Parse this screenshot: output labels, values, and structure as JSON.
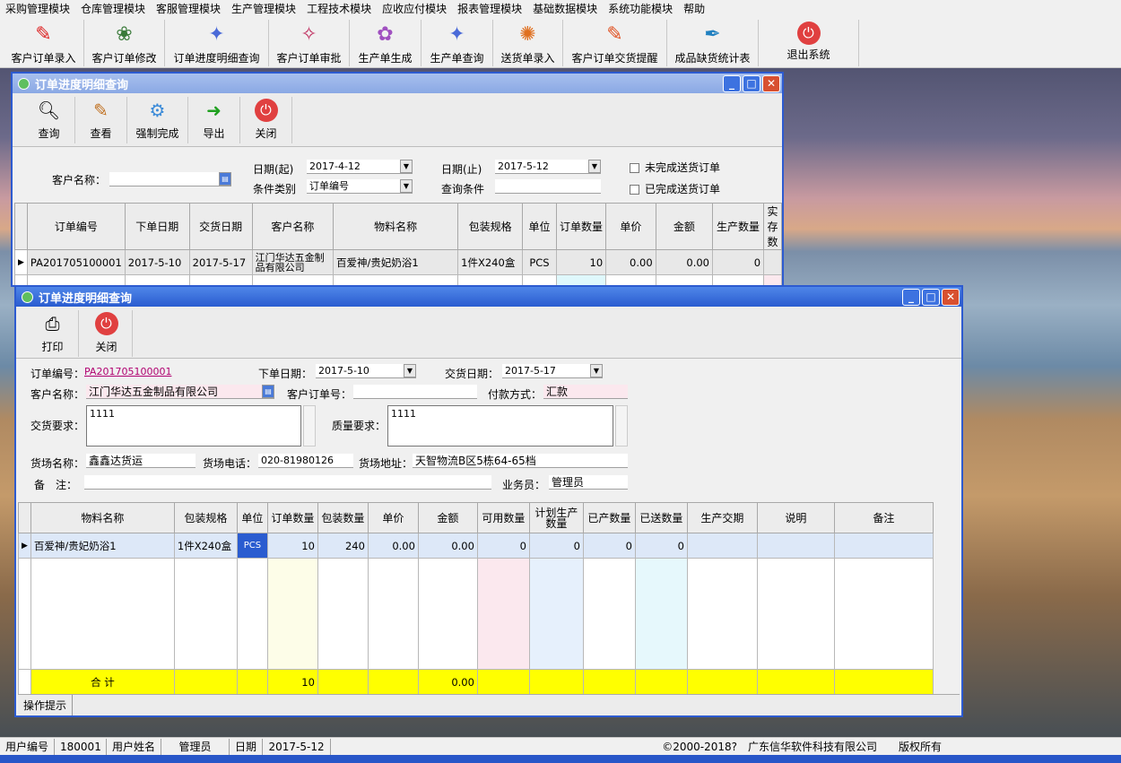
{
  "menu": [
    "采购管理模块",
    "仓库管理模块",
    "客服管理模块",
    "生产管理模块",
    "工程技术模块",
    "应收应付模块",
    "报表管理模块",
    "基础数据模块",
    "系统功能模块",
    "帮助"
  ],
  "toolbar": {
    "order_entry": "客户订单录入",
    "order_modify": "客户订单修改",
    "progress_query": "订单进度明细查询",
    "order_approve": "客户订单审批",
    "production_create": "生产单生成",
    "production_query": "生产单查询",
    "delivery_entry": "送货单录入",
    "delivery_reminder": "客户订单交货提醒",
    "shortage_stats": "成品缺货统计表",
    "exit": "退出系统"
  },
  "win1": {
    "title": "订单进度明细查询",
    "buttons": {
      "query": "查询",
      "view": "查看",
      "force": "强制完成",
      "export": "导出",
      "close": "关闭"
    },
    "filter": {
      "customer_label": "客户名称：",
      "customer_value": "",
      "date_from_label": "日期(起)",
      "date_from": "2017-4-12",
      "date_to_label": "日期(止)",
      "date_to": "2017-5-12",
      "cond_type_label": "条件类别",
      "cond_type": "订单编号",
      "cond_label": "查询条件",
      "cond_value": "",
      "unfinished_label": "未完成送货订单",
      "finished_label": "已完成送货订单"
    },
    "columns": [
      "订单编号",
      "下单日期",
      "交货日期",
      "客户名称",
      "物料名称",
      "包装规格",
      "单位",
      "订单数量",
      "单价",
      "金额",
      "生产数量",
      "实存数"
    ],
    "rows": [
      [
        "PA201705100001",
        "2017-5-10",
        "2017-5-17",
        "江门华达五金制品有限公司",
        "百爱神/贵妃奶浴1",
        "1件X240盒",
        "PCS",
        "10",
        "0.00",
        "0.00",
        "0",
        ""
      ]
    ]
  },
  "win2": {
    "title": "订单进度明细查询",
    "buttons": {
      "print": "打印",
      "close": "关闭"
    },
    "form": {
      "order_no_label": "订单编号：",
      "order_no": "PA201705100001",
      "order_date_label": "下单日期：",
      "order_date": "2017-5-10",
      "delivery_date_label": "交货日期：",
      "delivery_date": "2017-5-17",
      "customer_label": "客户名称：",
      "customer": "江门华达五金制品有限公司",
      "cust_order_label": "客户订单号：",
      "cust_order": "",
      "payment_label": "付款方式：",
      "payment": "汇款",
      "delivery_req_label": "交货要求：",
      "delivery_req": "1111",
      "quality_req_label": "质量要求：",
      "quality_req": "1111",
      "yard_name_label": "货场名称：",
      "yard_name": "鑫鑫达货运",
      "yard_phone_label": "货场电话：",
      "yard_phone": "020-81980126",
      "yard_addr_label": "货场地址：",
      "yard_addr": "天智物流B区5栋64-65档",
      "remark_label": "备　注：",
      "remark": "",
      "salesman_label": "业务员：",
      "salesman": "管理员"
    },
    "columns": [
      "物料名称",
      "包装规格",
      "单位",
      "订单数量",
      "包装数量",
      "单价",
      "金额",
      "可用数量",
      "计划生产数量",
      "已产数量",
      "已送数量",
      "生产交期",
      "说明",
      "备注"
    ],
    "rows": [
      [
        "百爱神/贵妃奶浴1",
        "1件X240盒",
        "PCS",
        "10",
        "240",
        "0.00",
        "0.00",
        "0",
        "0",
        "0",
        "0",
        "",
        "",
        ""
      ]
    ],
    "total_label": "合 计",
    "total_qty": "10",
    "total_amount": "0.00",
    "hint": "操作提示"
  },
  "status": {
    "user_no_label": "用户编号",
    "user_no": "180001",
    "user_name_label": "用户姓名",
    "user_name": "管理员",
    "date_label": "日期",
    "date": "2017-5-12",
    "copyright": "©2000-2018?　广东信华软件科技有限公司　　版权所有"
  },
  "colors": {
    "title_active": "#2a5cd0",
    "total_row": "#ffff00"
  }
}
